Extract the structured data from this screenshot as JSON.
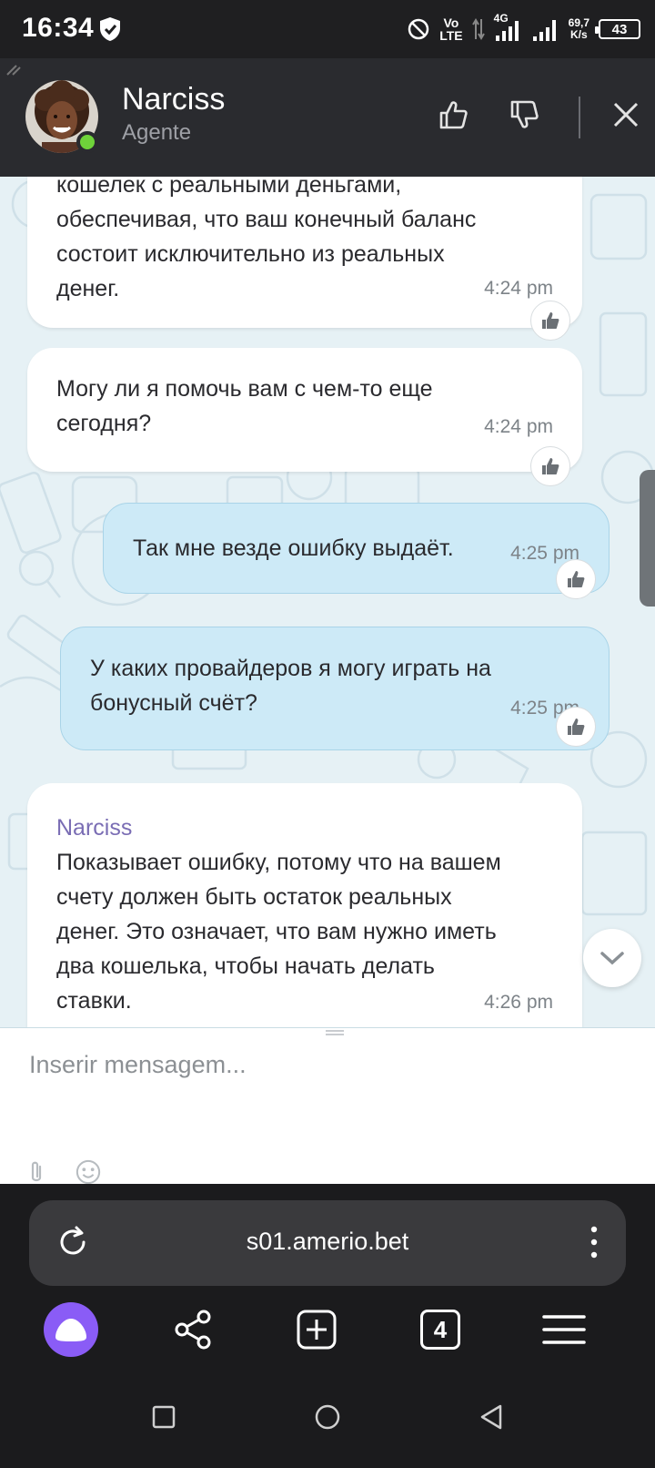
{
  "status_bar": {
    "time": "16:34",
    "network_vo": "Vo",
    "network_lte": "LTE",
    "network_4g": "4G",
    "speed_value": "69,7",
    "speed_unit": "K/s",
    "battery": "43"
  },
  "chat_header": {
    "agent_name": "Narciss",
    "agent_role": "Agente",
    "online_color": "#6fd33a"
  },
  "messages": [
    {
      "from": "agent",
      "text": "кошелек с реальными деньгами, обеспечивая, что ваш конечный баланс состоит исключительно из реальных денег.",
      "lines": [
        "кошелек с реальными деньгами,",
        "обеспечивая, что ваш конечный баланс",
        "состоит исключительно из реальных",
        "денег."
      ],
      "time": "4:24 pm"
    },
    {
      "from": "agent",
      "lines": [
        "Могу ли я помочь вам с чем-то еще",
        "сегодня?"
      ],
      "time": "4:24 pm"
    },
    {
      "from": "user",
      "lines": [
        "Так мне везде ошибку выдаёт."
      ],
      "time": "4:25 pm"
    },
    {
      "from": "user",
      "lines": [
        "У каких провайдеров я могу играть на",
        "бонусный счёт?"
      ],
      "time": "4:25 pm"
    },
    {
      "from": "agent",
      "sender": "Narciss",
      "lines": [
        "Показывает ошибку, потому что на вашем",
        "счету должен быть остаток реальных",
        "денег. Это означает, что вам нужно иметь",
        "два кошелька, чтобы начать делать",
        "ставки."
      ],
      "time": "4:26 pm"
    }
  ],
  "composer": {
    "placeholder": "Inserir mensagem..."
  },
  "browser": {
    "url": "s01.amerio.bet",
    "tab_count": "4",
    "alice_color": "#8a5cf6"
  },
  "colors": {
    "chat_background": "#e6f1f5",
    "user_bubble": "#cdeaf7",
    "agent_bubble": "#ffffff",
    "sender_name": "#7a6db4"
  }
}
